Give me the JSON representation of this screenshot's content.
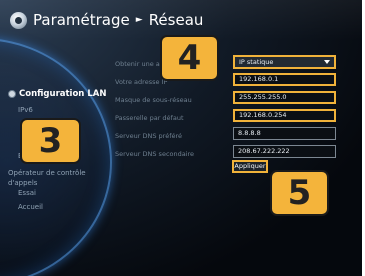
{
  "header": {
    "title": "Paramétrage",
    "separator": "►",
    "section": "Réseau"
  },
  "sidebar": {
    "active_item": "Configuration LAN",
    "items": [
      {
        "label": "IPv6"
      },
      {
        "label": "Bl"
      },
      {
        "label": "Opérateur de contrôle d'appels"
      },
      {
        "label": "Essai"
      },
      {
        "label": "Accueil"
      }
    ]
  },
  "form": {
    "fields": [
      {
        "label": "Obtenir une adresse IP",
        "value": "IP statique",
        "type": "select"
      },
      {
        "label": "Votre adresse IP",
        "value": "192.168.0.1"
      },
      {
        "label": "Masque de sous-réseau",
        "value": "255.255.255.0"
      },
      {
        "label": "Passerelle par défaut",
        "value": "192.168.0.254"
      },
      {
        "label": "Serveur DNS préféré",
        "value": "8.8.8.8"
      },
      {
        "label": "Serveur DNS secondaire",
        "value": "208.67.222.222"
      }
    ],
    "apply_label": "Appliquer"
  },
  "callouts": {
    "three": "3",
    "four": "4",
    "five": "5"
  },
  "colors": {
    "highlight": "#f0b23a",
    "badge": "#f4b43b"
  }
}
